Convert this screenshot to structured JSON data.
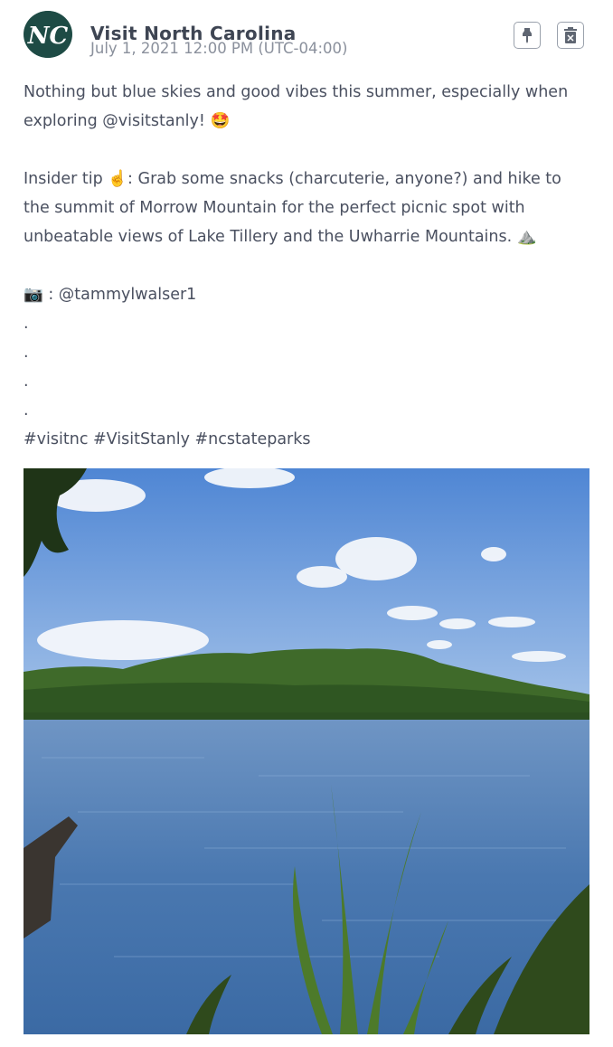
{
  "post": {
    "author": "Visit North Carolina",
    "avatar_text": "NC",
    "timestamp": "July 1, 2021 12:00 PM (UTC-04:00)",
    "caption_lines": [
      "Nothing but blue skies and good vibes this summer, especially when",
      "exploring @visitstanly! 🤩",
      "",
      "Insider tip ☝️: Grab some snacks (charcuterie, anyone?) and hike to",
      "the summit of Morrow Mountain for the perfect picnic spot with",
      "unbeatable views of Lake Tillery and the Uwharrie Mountains. ⛰️",
      "",
      "📷 : @tammylwalser1",
      ".",
      ".",
      ".",
      ".",
      "#visitnc #VisitStanly #ncstateparks"
    ]
  },
  "actions": {
    "pin_icon": "pin-icon",
    "delete_icon": "trash-icon"
  },
  "colors": {
    "avatar_bg": "#1e4b45",
    "text": "#4a5060",
    "muted": "#8a909c",
    "sky": "#5b8fd6",
    "water": "#4a78b0",
    "trees": "#3f6a2a"
  }
}
